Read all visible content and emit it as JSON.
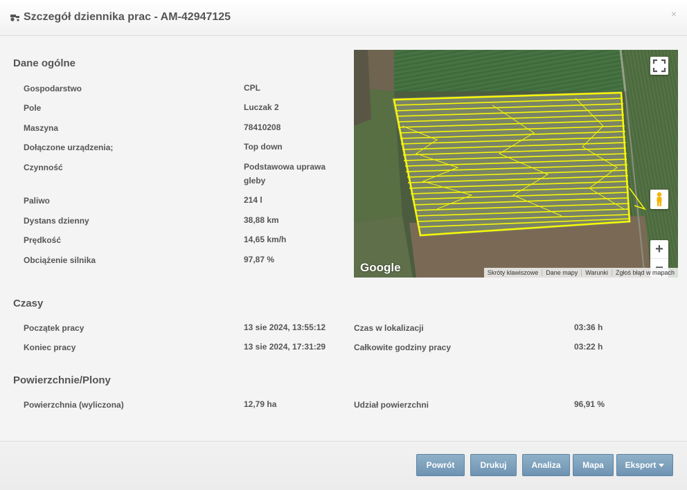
{
  "header": {
    "title": "Szczegół dziennika prac - AM-42947125",
    "close": "×"
  },
  "general": {
    "title": "Dane ogólne",
    "rows": [
      {
        "label": "Gospodarstwo",
        "value": "CPL"
      },
      {
        "label": "Pole",
        "value": "Luczak 2"
      },
      {
        "label": "Maszyna",
        "value": "78410208"
      },
      {
        "label": "Dołączone urządzenia;",
        "value": "Top down"
      },
      {
        "label": "Czynność",
        "value": "Podstawowa uprawa",
        "value2": "gleby"
      },
      {
        "label": "Paliwo",
        "value": "214 l"
      },
      {
        "label": "Dystans dzienny",
        "value": "38,88 km"
      },
      {
        "label": "Prędkość",
        "value": "14,65 km/h"
      },
      {
        "label": "Obciążenie silnika",
        "value": "97,87 %"
      }
    ]
  },
  "times": {
    "title": "Czasy",
    "rows": [
      {
        "label": "Początek pracy",
        "value": "13 sie 2024, 13:55:12",
        "label2": "Czas w lokalizacji",
        "value2": "03:36 h"
      },
      {
        "label": "Koniec pracy",
        "value": "13 sie 2024, 17:31:29",
        "label2": "Całkowite godziny pracy",
        "value2": "03:22 h"
      }
    ]
  },
  "areas": {
    "title": "Powierzchnie/Plony",
    "rows": [
      {
        "label": "Powierzchnia (wyliczona)",
        "value": "12,79 ha",
        "label2": "Udział powierzchni",
        "value2": "96,91 %"
      }
    ]
  },
  "map": {
    "logo": "Google",
    "attribution": [
      "Skróty klawiszowe",
      "Dane mapy",
      "Warunki",
      "Zgłoś błąd w mapach"
    ],
    "zoom_in": "+",
    "zoom_out": "−",
    "track_color": "#ffff00"
  },
  "footer": {
    "buttons": [
      "Powrót",
      "Drukuj",
      "Analiza",
      "Mapa",
      "Eksport"
    ]
  }
}
